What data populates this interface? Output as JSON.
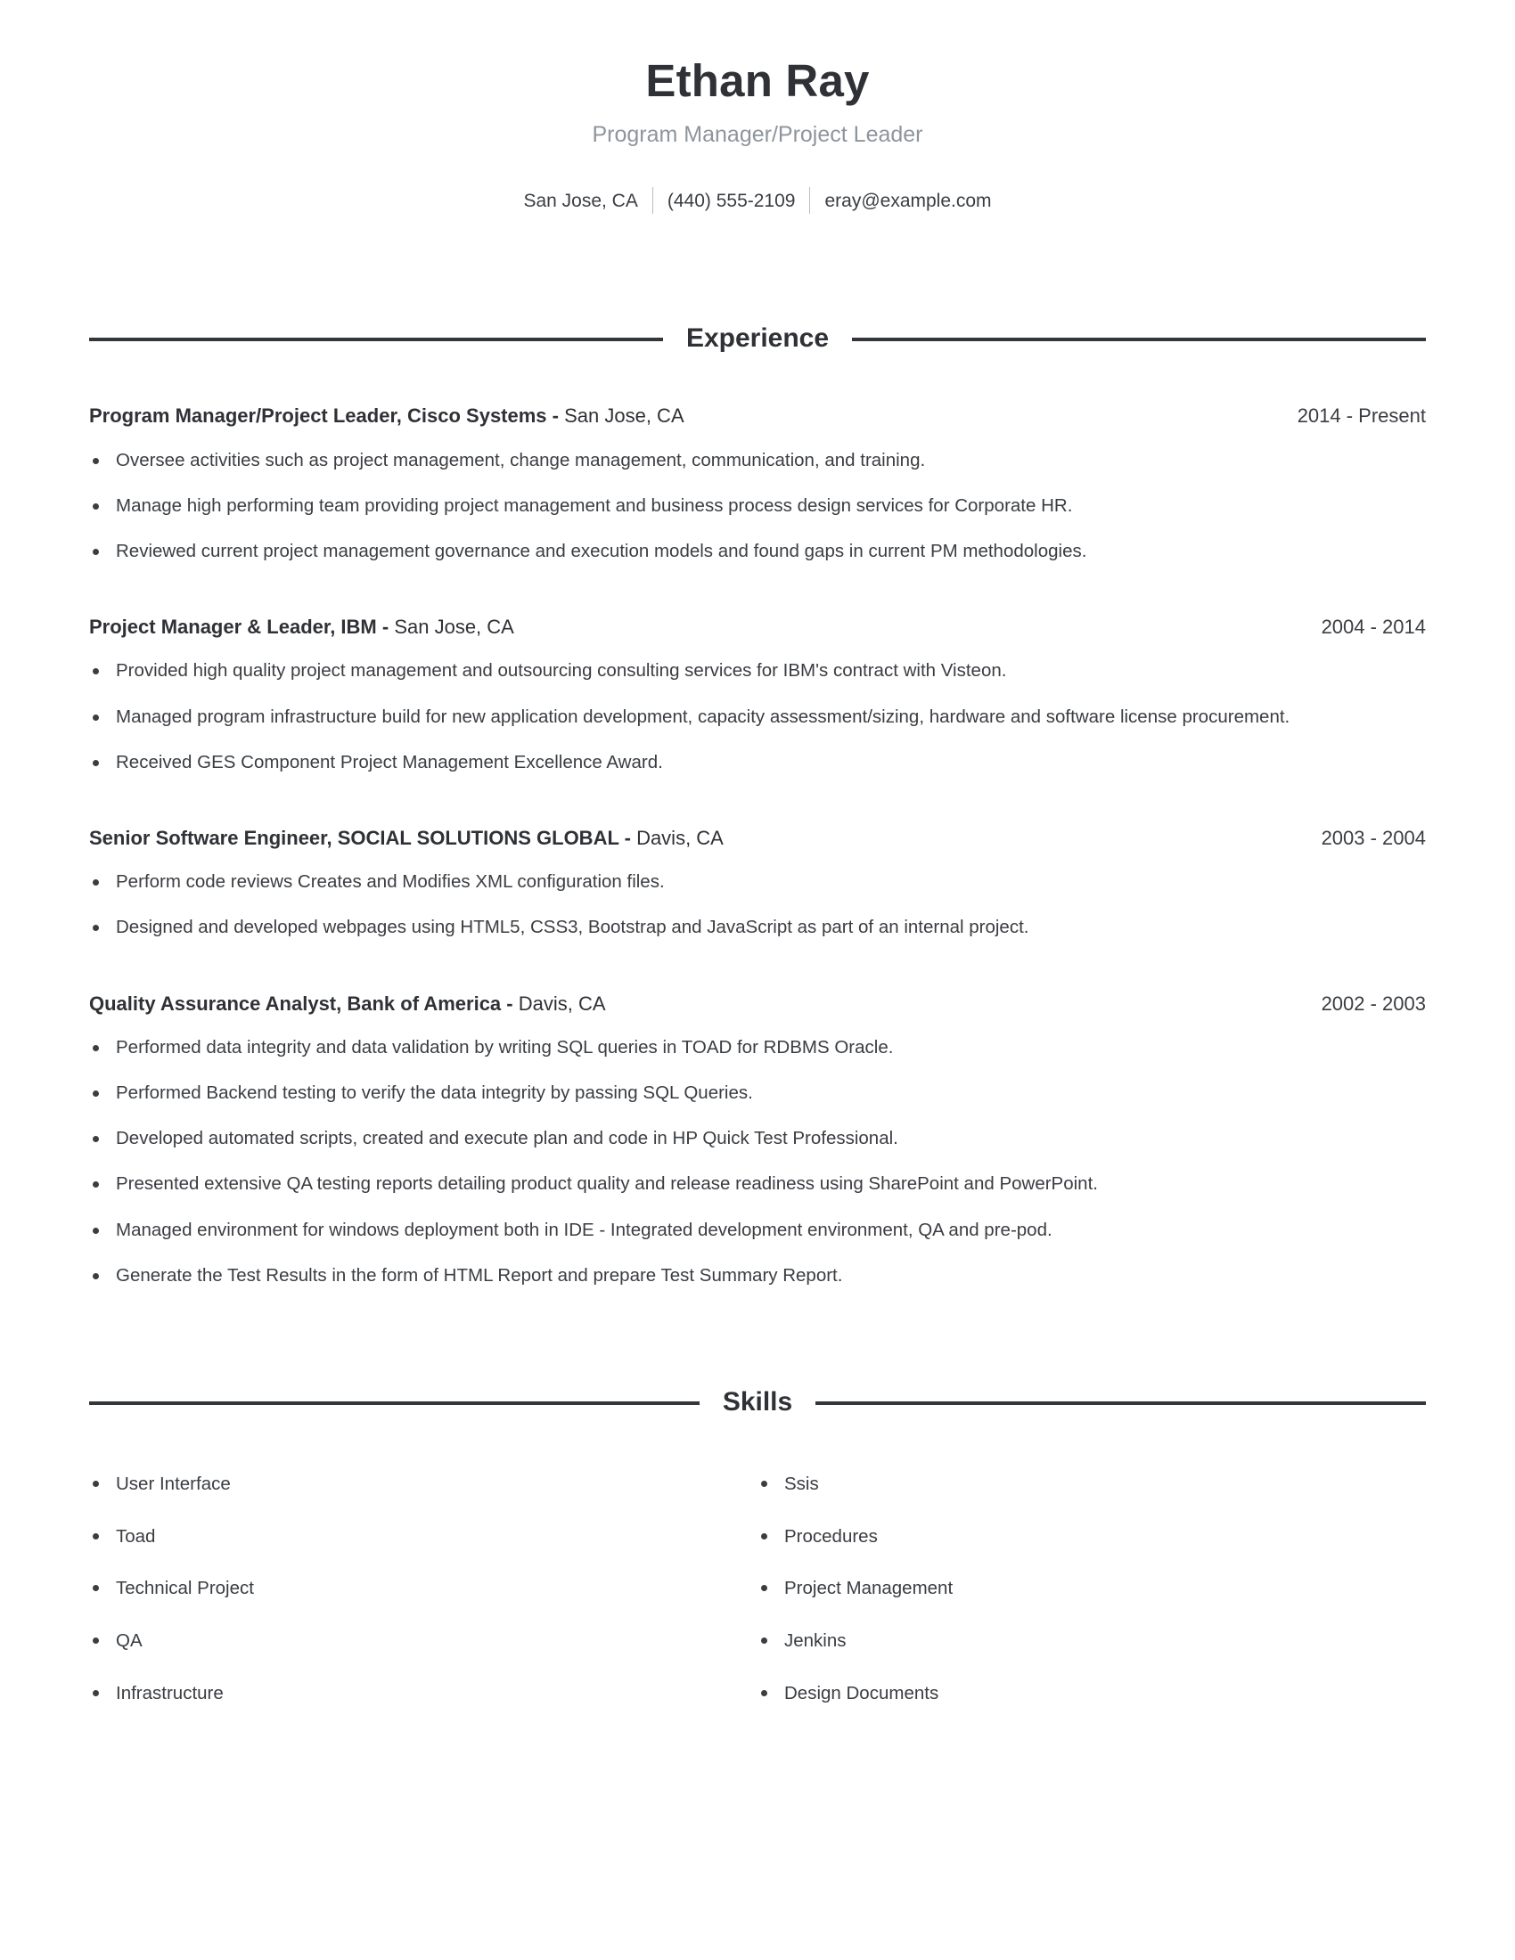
{
  "header": {
    "full_name": "Ethan Ray",
    "job_subtitle": "Program Manager/Project Leader",
    "contact": {
      "location": "San Jose, CA",
      "phone": "(440) 555-2109",
      "email": "eray@example.com"
    }
  },
  "sections": {
    "experience": {
      "title": "Experience",
      "jobs": [
        {
          "role": "Program Manager/Project Leader, Cisco Systems",
          "separator": " - ",
          "location": "San Jose, CA",
          "dates": "2014 - Present",
          "bullets": [
            "Oversee activities such as project management, change management, communication, and training.",
            "Manage high performing team providing project management and business process design services for Corporate HR.",
            "Reviewed current project management governance and execution models and found gaps in current PM methodologies."
          ]
        },
        {
          "role": "Project Manager & Leader, IBM",
          "separator": " - ",
          "location": "San Jose, CA",
          "dates": "2004 - 2014",
          "bullets": [
            "Provided high quality project management and outsourcing consulting services for IBM's contract with Visteon.",
            "Managed program infrastructure build for new application development, capacity assessment/sizing, hardware and software license procurement.",
            "Received GES Component Project Management Excellence Award."
          ]
        },
        {
          "role": "Senior Software Engineer, SOCIAL SOLUTIONS GLOBAL",
          "separator": " - ",
          "location": "Davis, CA",
          "dates": "2003 - 2004",
          "bullets": [
            "Perform code reviews Creates and Modifies XML configuration files.",
            "Designed and developed webpages using HTML5, CSS3, Bootstrap and JavaScript as part of an internal project."
          ]
        },
        {
          "role": "Quality Assurance Analyst, Bank of America",
          "separator": " - ",
          "location": "Davis, CA",
          "dates": "2002 - 2003",
          "bullets": [
            "Performed data integrity and data validation by writing SQL queries in TOAD for RDBMS Oracle.",
            "Performed Backend testing to verify the data integrity by passing SQL Queries.",
            "Developed automated scripts, created and execute plan and code in HP Quick Test Professional.",
            "Presented extensive QA testing reports detailing product quality and release readiness using SharePoint and PowerPoint.",
            "Managed environment for windows deployment both in IDE - Integrated development environment, QA and pre-pod.",
            "Generate the Test Results in the form of HTML Report and prepare Test Summary Report."
          ]
        }
      ]
    },
    "skills": {
      "title": "Skills",
      "left_column": [
        "User Interface",
        "Toad",
        "Technical Project",
        "QA",
        "Infrastructure"
      ],
      "right_column": [
        "Ssis",
        "Procedures",
        "Project Management",
        "Jenkins",
        "Design Documents"
      ]
    }
  },
  "colors": {
    "text": "#3a3d42",
    "heading": "#2f3136",
    "subtitle": "#8e959c",
    "rule": "#33363b",
    "background": "#ffffff"
  }
}
